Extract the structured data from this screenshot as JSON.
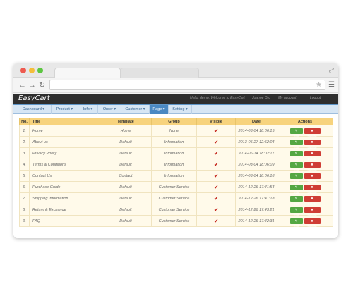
{
  "browser": {
    "nav_back": "←",
    "nav_forward": "→",
    "nav_reload": "↻",
    "star_icon": "★",
    "menu_icon": "☰",
    "expand_icon": "⤢"
  },
  "app": {
    "brand": "EasyCart",
    "greeting": "Hello, demo. Welcome to EasyCart",
    "site_link": "Joanne Org",
    "account_link": "My account",
    "logout_link": "Logout"
  },
  "nav": [
    {
      "label": "Dashboard ▾"
    },
    {
      "label": "Product ▾"
    },
    {
      "label": "Info ▾"
    },
    {
      "label": "Order ▾"
    },
    {
      "label": "Customer ▾"
    },
    {
      "label": "Page ▾"
    },
    {
      "label": "Setting ▾"
    }
  ],
  "table": {
    "headers": [
      "No.",
      "Title",
      "Template",
      "Group",
      "Visible",
      "Date",
      "Actions"
    ],
    "edit_label": "✎ Edit",
    "delete_label": "✖ Delete",
    "check_glyph": "✔",
    "rows": [
      {
        "no": "1.",
        "title": "Home",
        "template": "Home",
        "group": "None",
        "date": "2014-03-04 18:06:15"
      },
      {
        "no": "2.",
        "title": "About us",
        "template": "Default",
        "group": "Information",
        "date": "2013-05-27 12:52:04"
      },
      {
        "no": "3.",
        "title": "Privacy Policy",
        "template": "Default",
        "group": "Information",
        "date": "2014-06-14 18:02:17"
      },
      {
        "no": "4.",
        "title": "Terms & Conditions",
        "template": "Default",
        "group": "Information",
        "date": "2014-03-04 18:06:09"
      },
      {
        "no": "5.",
        "title": "Contact Us",
        "template": "Contact",
        "group": "Information",
        "date": "2014-03-04 18:06:18"
      },
      {
        "no": "6.",
        "title": "Purchase Guide",
        "template": "Default",
        "group": "Customer Service",
        "date": "2014-12-26 17:41:54"
      },
      {
        "no": "7.",
        "title": "Shipping Information",
        "template": "Default",
        "group": "Customer Service",
        "date": "2014-12-26 17:41:18"
      },
      {
        "no": "8.",
        "title": "Return & Exchange",
        "template": "Default",
        "group": "Customer Service",
        "date": "2014-12-26 17:43:21"
      },
      {
        "no": "9.",
        "title": "FAQ",
        "template": "Default",
        "group": "Customer Service",
        "date": "2014-12-26 17:42:31"
      }
    ]
  }
}
